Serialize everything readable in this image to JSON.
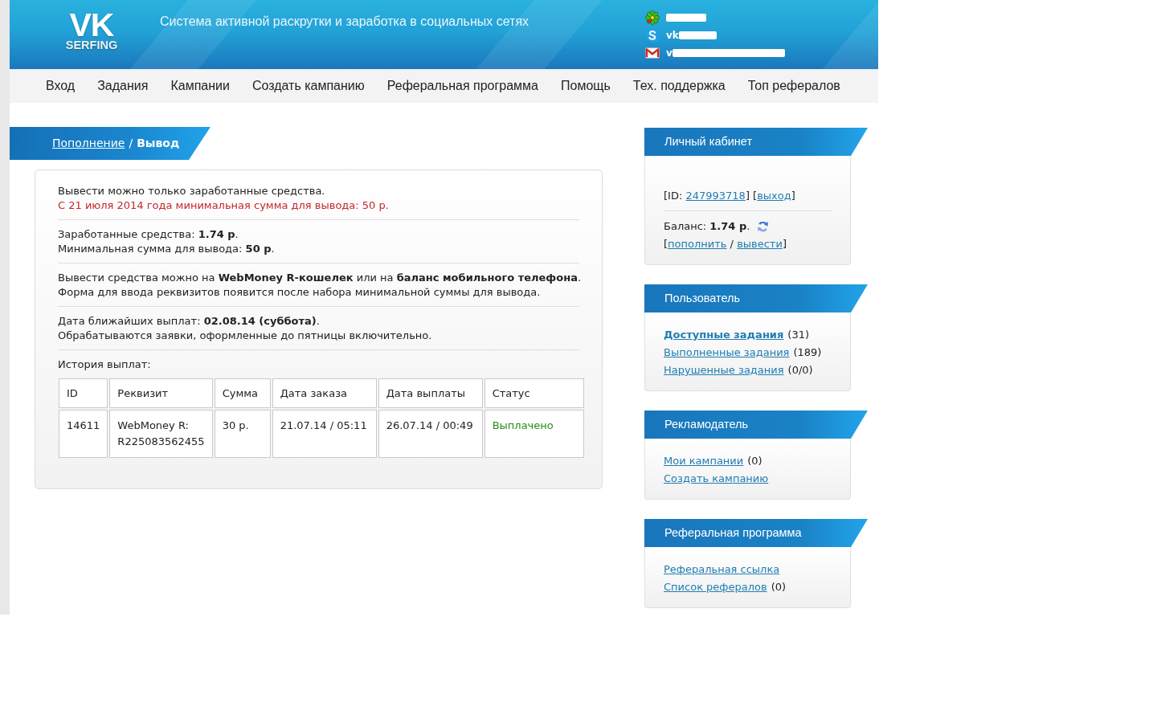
{
  "header": {
    "logo": {
      "title": "VK",
      "subtitle": "SERFING"
    },
    "tagline": "Система активной раскрутки и заработка в социальных сетях",
    "contacts": [
      {
        "kind": "icq",
        "redacted": true
      },
      {
        "kind": "skype",
        "text": "vk",
        "redacted": true
      },
      {
        "kind": "email",
        "text": "v",
        "redacted": true
      }
    ]
  },
  "nav": [
    "Вход",
    "Задания",
    "Кампании",
    "Создать кампанию",
    "Реферальная программа",
    "Помощь",
    "Тех. поддержка",
    "Топ рефералов"
  ],
  "breadcrumb": {
    "link": "Пополнение",
    "separator": "/",
    "current": "Вывод"
  },
  "withdrawal": {
    "sections": [
      {
        "lines": [
          {
            "kind": "info",
            "text": "Вывести можно только заработанные средства."
          },
          {
            "kind": "warning",
            "text": "С 21 июля 2014 года минимальная сумма для вывода: 50 р."
          }
        ]
      },
      {
        "lines": [
          {
            "kind": "info",
            "text": "Заработанные средства: **1.74 р**."
          },
          {
            "kind": "info",
            "text": "Минимальная сумма для вывода: **50 р**."
          }
        ]
      },
      {
        "lines": [
          {
            "kind": "info",
            "text": "Вывести средства можно на **WebMoney R-кошелек** или на **баланс мобильного телефона**."
          },
          {
            "kind": "info",
            "text": "Форма для ввода реквизитов появится после набора минимальной суммы для вывода."
          }
        ]
      },
      {
        "lines": [
          {
            "kind": "info",
            "text": "Дата ближайших выплат: **02.08.14 (суббота)**."
          },
          {
            "kind": "info",
            "text": "Обрабатываются заявки, оформленные до пятницы включительно."
          }
        ]
      }
    ],
    "history": {
      "title": "История выплат:",
      "columns": [
        "ID",
        "Реквизит",
        "Сумма",
        "Дата заказа",
        "Дата выплаты",
        "Статус"
      ],
      "rows": [
        {
          "cells": [
            {
              "kind": "plain",
              "text": "14611"
            },
            {
              "kind": "plain",
              "text": "WebMoney R:\nR225083562455"
            },
            {
              "kind": "plain",
              "text": "30 р."
            },
            {
              "kind": "plain",
              "text": "21.07.14 / 05:11"
            },
            {
              "kind": "plain",
              "text": "26.07.14 / 00:49"
            },
            {
              "kind": "paid",
              "text": "Выплачено"
            }
          ]
        }
      ]
    }
  },
  "sidebar": [
    {
      "kind": "account",
      "title": "Личный кабинет",
      "id_line": [
        {
          "kind": "text",
          "text": "[ID: "
        },
        {
          "kind": "link",
          "text": "247993718"
        },
        {
          "kind": "text",
          "text": "] ["
        },
        {
          "kind": "link",
          "text": "выход"
        },
        {
          "kind": "text",
          "text": "]"
        }
      ],
      "balance": "Баланс: **1.74 р**.",
      "actions": [
        {
          "kind": "text",
          "text": "["
        },
        {
          "kind": "link",
          "text": "пополнить"
        },
        {
          "kind": "text",
          "text": " / "
        },
        {
          "kind": "link",
          "text": "вывести"
        },
        {
          "kind": "text",
          "text": "]"
        }
      ]
    },
    {
      "kind": "links",
      "title": "Пользователь",
      "links": [
        {
          "text": "Доступные задания",
          "count": "(31)",
          "bold": true
        },
        {
          "text": "Выполненные задания",
          "count": "(189)",
          "bold": false
        },
        {
          "text": "Нарушенные задания",
          "count": "(0/0)",
          "bold": false
        }
      ]
    },
    {
      "kind": "links",
      "title": "Рекламодатель",
      "links": [
        {
          "text": "Мои кампании",
          "count": "(0)",
          "bold": false
        },
        {
          "text": "Создать кампанию",
          "bold": false
        }
      ]
    },
    {
      "kind": "links",
      "title": "Реферальная программа",
      "links": [
        {
          "text": "Реферальная ссылка",
          "bold": false
        },
        {
          "text": "Список рефералов",
          "count": "(0)",
          "bold": false
        }
      ]
    }
  ]
}
